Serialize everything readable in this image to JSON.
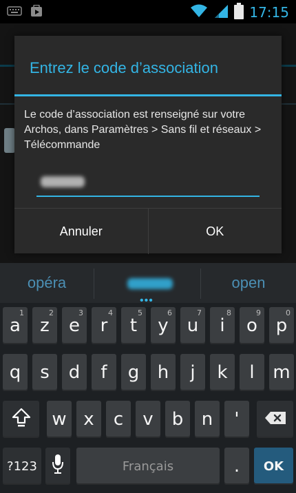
{
  "status_bar": {
    "time": "17:15",
    "icons": [
      "keyboard-icon",
      "play-store-icon",
      "wifi-icon",
      "signal-icon",
      "battery-icon"
    ]
  },
  "dialog": {
    "title": "Entrez le code d’association",
    "message": "Le code d’association est renseigné sur votre Archos, dans Paramètres >  Sans fil et réseaux > Télécommande",
    "cancel_label": "Annuler",
    "ok_label": "OK"
  },
  "keyboard": {
    "suggestions": {
      "left": "opéra",
      "center_dots": "•••",
      "right": "open"
    },
    "row1": [
      {
        "label": "a",
        "hint": "1"
      },
      {
        "label": "z",
        "hint": "2"
      },
      {
        "label": "e",
        "hint": "3"
      },
      {
        "label": "r",
        "hint": "4"
      },
      {
        "label": "t",
        "hint": "5"
      },
      {
        "label": "y",
        "hint": "6"
      },
      {
        "label": "u",
        "hint": "7"
      },
      {
        "label": "i",
        "hint": "8"
      },
      {
        "label": "o",
        "hint": "9"
      },
      {
        "label": "p",
        "hint": "0"
      }
    ],
    "row2": [
      "q",
      "s",
      "d",
      "f",
      "g",
      "h",
      "j",
      "k",
      "l",
      "m"
    ],
    "row3": [
      "w",
      "x",
      "c",
      "v",
      "b",
      "n",
      "'"
    ],
    "bottom": {
      "sym_label": "?123",
      "space_label": "Français",
      "period_label": ".",
      "ok_label": "OK"
    },
    "accent_color": "#33b5e5"
  }
}
